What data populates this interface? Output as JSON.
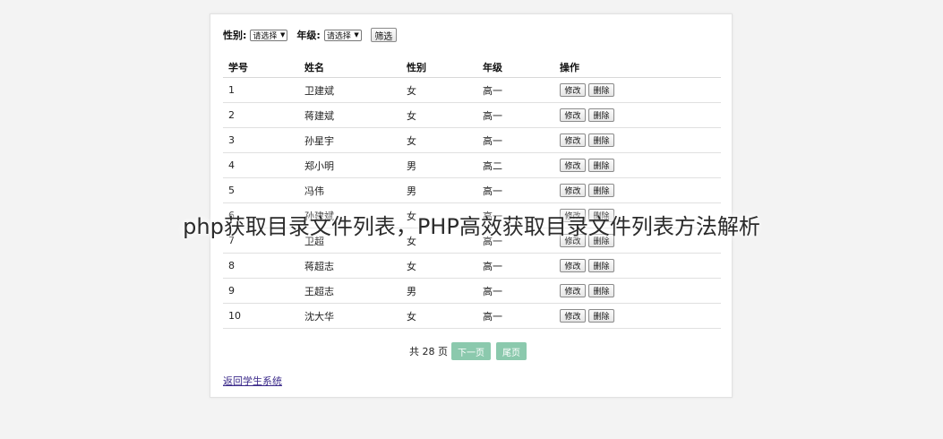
{
  "filter": {
    "gender_label": "性别:",
    "gender_select": "请选择",
    "grade_label": "年级:",
    "grade_select": "请选择",
    "filter_button": "筛选"
  },
  "table": {
    "headers": [
      "学号",
      "姓名",
      "性别",
      "年级",
      "操作"
    ],
    "rows": [
      {
        "id": "1",
        "name": "卫建斌",
        "gender": "女",
        "grade": "高一"
      },
      {
        "id": "2",
        "name": "蒋建斌",
        "gender": "女",
        "grade": "高一"
      },
      {
        "id": "3",
        "name": "孙星宇",
        "gender": "女",
        "grade": "高一"
      },
      {
        "id": "4",
        "name": "郑小明",
        "gender": "男",
        "grade": "高二"
      },
      {
        "id": "5",
        "name": "冯伟",
        "gender": "男",
        "grade": "高一"
      },
      {
        "id": "6",
        "name": "孙建斌",
        "gender": "女",
        "grade": "高一"
      },
      {
        "id": "7",
        "name": "卫超",
        "gender": "女",
        "grade": "高一"
      },
      {
        "id": "8",
        "name": "蒋超志",
        "gender": "女",
        "grade": "高一"
      },
      {
        "id": "9",
        "name": "王超志",
        "gender": "男",
        "grade": "高一"
      },
      {
        "id": "10",
        "name": "沈大华",
        "gender": "女",
        "grade": "高一"
      }
    ],
    "edit_label": "修改",
    "delete_label": "删除"
  },
  "pager": {
    "total_text": "共 28 页",
    "next_label": "下一页",
    "last_label": "尾页"
  },
  "back_link": "返回学生系统",
  "overlay_caption": "php获取目录文件列表，PHP高效获取目录文件列表方法解析",
  "colors": {
    "pager_button": "#8bc9ad",
    "link": "#3b2a8a"
  }
}
